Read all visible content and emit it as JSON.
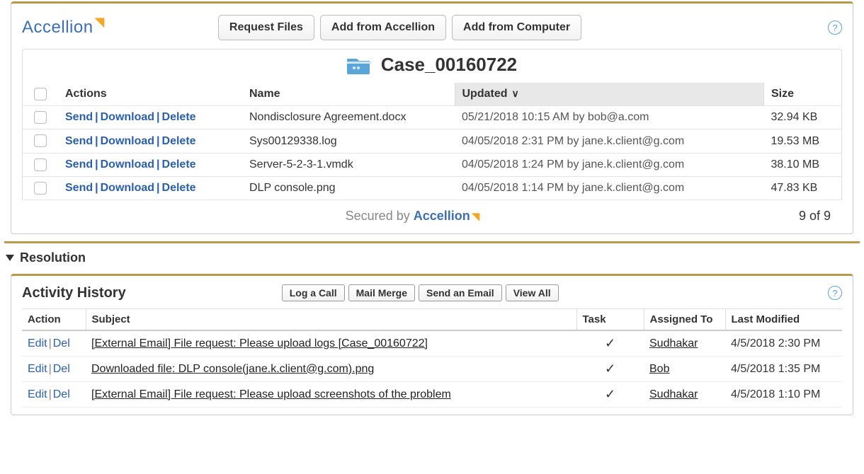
{
  "accellion": {
    "brand": "Accellion",
    "buttons": {
      "request_files": "Request Files",
      "add_from_accellion": "Add from Accellion",
      "add_from_computer": "Add from Computer"
    },
    "folder_title": "Case_00160722",
    "columns": {
      "actions": "Actions",
      "name": "Name",
      "updated": "Updated",
      "size": "Size"
    },
    "action_labels": {
      "send": "Send",
      "download": "Download",
      "delete": "Delete"
    },
    "files": [
      {
        "name": "Nondisclosure Agreement.docx",
        "updated": "05/21/2018 10:15 AM by bob@a.com",
        "size": "32.94 KB"
      },
      {
        "name": "Sys00129338.log",
        "updated": "04/05/2018 2:31 PM by jane.k.client@g.com",
        "size": "19.53 MB"
      },
      {
        "name": "Server-5-2-3-1.vmdk",
        "updated": "04/05/2018 1:24 PM by jane.k.client@g.com",
        "size": "38.10 MB"
      },
      {
        "name": "DLP console.png",
        "updated": "04/05/2018 1:14 PM by jane.k.client@g.com",
        "size": "47.83 KB"
      }
    ],
    "secured_by_prefix": "Secured by ",
    "count": "9 of 9"
  },
  "resolution_label": "Resolution",
  "activity": {
    "title": "Activity History",
    "buttons": {
      "log_call": "Log a Call",
      "mail_merge": "Mail Merge",
      "send_email": "Send an Email",
      "view_all": "View All"
    },
    "columns": {
      "action": "Action",
      "subject": "Subject",
      "task": "Task",
      "assigned_to": "Assigned To",
      "last_modified": "Last Modified"
    },
    "action_labels": {
      "edit": "Edit",
      "del": "Del"
    },
    "rows": [
      {
        "subject": "[External Email] File request: Please upload logs [Case_00160722]",
        "task": true,
        "assigned_to": "Sudhakar ",
        "last_modified": "4/5/2018 2:30 PM"
      },
      {
        "subject": "Downloaded file: DLP console(jane.k.client@g.com).png",
        "task": true,
        "assigned_to": "Bob",
        "last_modified": "4/5/2018 1:35 PM"
      },
      {
        "subject": "[External Email] File request: Please upload screenshots of the problem",
        "task": true,
        "assigned_to": "Sudhakar ",
        "last_modified": "4/5/2018 1:10 PM"
      }
    ]
  }
}
